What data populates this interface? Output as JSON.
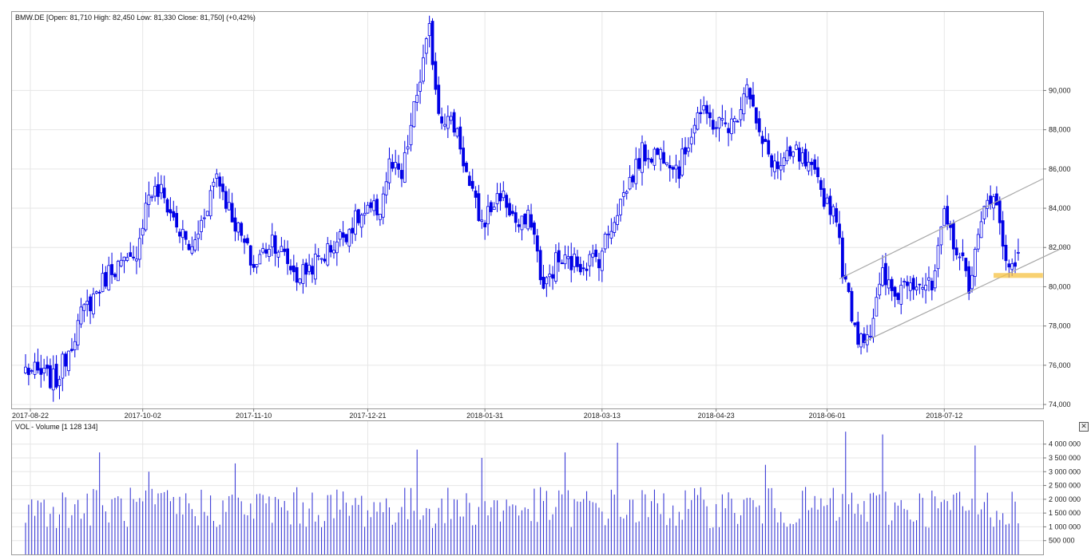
{
  "header": {
    "legend": "BMW.DE [Open: 81,710  High: 82,450  Low: 81,330  Close: 81,750] (+0,42%)"
  },
  "volume_panel": {
    "legend": "VOL - Volume [1 128 134]",
    "close_glyph": "✕"
  },
  "colors": {
    "candle": "#0000e6",
    "volume": "#3a3ad6",
    "grid": "#e6e6e6",
    "frame": "#999999",
    "channel": "#a8a8a8",
    "support_zone": "#f5c242"
  },
  "chart_data": [
    {
      "type": "candlestick",
      "title": "BMW.DE",
      "x_tick_labels": [
        "2017-08-22",
        "2017-10-02",
        "2017-11-10",
        "2017-12-21",
        "2018-01-31",
        "2018-03-13",
        "2018-04-23",
        "2018-06-01",
        "2018-07-12"
      ],
      "y_tick_labels": [
        "74,000",
        "76,000",
        "78,000",
        "80,000",
        "82,000",
        "84,000",
        "86,000",
        "88,000",
        "90,000"
      ],
      "ylim": [
        73.8,
        94.0
      ],
      "grid": true,
      "last_bar": {
        "open": 81.71,
        "high": 82.45,
        "low": 81.33,
        "close": 81.75,
        "change_pct": 0.42
      },
      "anchors": [
        {
          "x": 0,
          "close": 75.8
        },
        {
          "x": 10,
          "close": 75.2
        },
        {
          "x": 18,
          "close": 78.5
        },
        {
          "x": 28,
          "close": 81.0
        },
        {
          "x": 35,
          "close": 81.2
        },
        {
          "x": 40,
          "close": 84.8
        },
        {
          "x": 44,
          "close": 84.8
        },
        {
          "x": 50,
          "close": 82.8
        },
        {
          "x": 54,
          "close": 81.8
        },
        {
          "x": 62,
          "close": 85.8
        },
        {
          "x": 66,
          "close": 84.0
        },
        {
          "x": 74,
          "close": 81.0
        },
        {
          "x": 80,
          "close": 82.5
        },
        {
          "x": 88,
          "close": 80.5
        },
        {
          "x": 96,
          "close": 81.5
        },
        {
          "x": 108,
          "close": 83.5
        },
        {
          "x": 115,
          "close": 84.0
        },
        {
          "x": 118,
          "close": 86.2
        },
        {
          "x": 122,
          "close": 85.5
        },
        {
          "x": 126,
          "close": 89.0
        },
        {
          "x": 131,
          "close": 93.0
        },
        {
          "x": 134,
          "close": 89.0
        },
        {
          "x": 140,
          "close": 88.0
        },
        {
          "x": 144,
          "close": 85.0
        },
        {
          "x": 148,
          "close": 83.2
        },
        {
          "x": 154,
          "close": 84.8
        },
        {
          "x": 160,
          "close": 83.0
        },
        {
          "x": 164,
          "close": 83.5
        },
        {
          "x": 168,
          "close": 79.8
        },
        {
          "x": 172,
          "close": 81.3
        },
        {
          "x": 180,
          "close": 81.2
        },
        {
          "x": 186,
          "close": 81.5
        },
        {
          "x": 192,
          "close": 84.0
        },
        {
          "x": 200,
          "close": 86.8
        },
        {
          "x": 208,
          "close": 86.8
        },
        {
          "x": 212,
          "close": 86.0
        },
        {
          "x": 218,
          "close": 88.9
        },
        {
          "x": 224,
          "close": 88.3
        },
        {
          "x": 230,
          "close": 88.3
        },
        {
          "x": 234,
          "close": 90.6
        },
        {
          "x": 238,
          "close": 87.5
        },
        {
          "x": 244,
          "close": 86.0
        },
        {
          "x": 250,
          "close": 86.8
        },
        {
          "x": 256,
          "close": 85.5
        },
        {
          "x": 260,
          "close": 84.3
        },
        {
          "x": 263,
          "close": 83.8
        },
        {
          "x": 264,
          "close": 82.0
        },
        {
          "x": 266,
          "close": 80.0
        },
        {
          "x": 270,
          "close": 77.5
        },
        {
          "x": 274,
          "close": 77.8
        },
        {
          "x": 278,
          "close": 80.5
        },
        {
          "x": 282,
          "close": 79.5
        },
        {
          "x": 286,
          "close": 80.5
        },
        {
          "x": 290,
          "close": 80.3
        },
        {
          "x": 294,
          "close": 79.8
        },
        {
          "x": 298,
          "close": 83.5
        },
        {
          "x": 302,
          "close": 82.0
        },
        {
          "x": 306,
          "close": 80.2
        },
        {
          "x": 312,
          "close": 84.5
        },
        {
          "x": 314,
          "close": 84.9
        },
        {
          "x": 318,
          "close": 81.2
        },
        {
          "x": 320,
          "close": 81.4
        },
        {
          "x": 322,
          "close": 81.75
        }
      ],
      "annotations": [
        {
          "type": "trend_channel",
          "line1": [
            [
              264,
              80.4
            ],
            [
              330,
              85.5
            ]
          ],
          "line2": [
            [
              272,
              77.2
            ],
            [
              338,
              82.1
            ]
          ]
        },
        {
          "type": "support_zone",
          "y_range": [
            80.45,
            80.7
          ],
          "x_range": [
            314,
            330
          ]
        }
      ]
    },
    {
      "type": "bar",
      "title": "VOL - Volume",
      "last_value": 1128134,
      "y_tick_labels": [
        "500 000",
        "1 000 000",
        "1 500 000",
        "2 000 000",
        "2 500 000",
        "3 000 000",
        "3 500 000",
        "4 000 000"
      ],
      "ylim": [
        0,
        4600000
      ],
      "spikes": [
        {
          "x": 24,
          "value": 3700000
        },
        {
          "x": 40,
          "value": 3000000
        },
        {
          "x": 68,
          "value": 3300000
        },
        {
          "x": 127,
          "value": 3800000
        },
        {
          "x": 148,
          "value": 3500000
        },
        {
          "x": 175,
          "value": 3700000
        },
        {
          "x": 192,
          "value": 4050000
        },
        {
          "x": 240,
          "value": 3250000
        },
        {
          "x": 266,
          "value": 4450000
        },
        {
          "x": 278,
          "value": 4350000
        },
        {
          "x": 308,
          "value": 3950000
        }
      ]
    }
  ]
}
